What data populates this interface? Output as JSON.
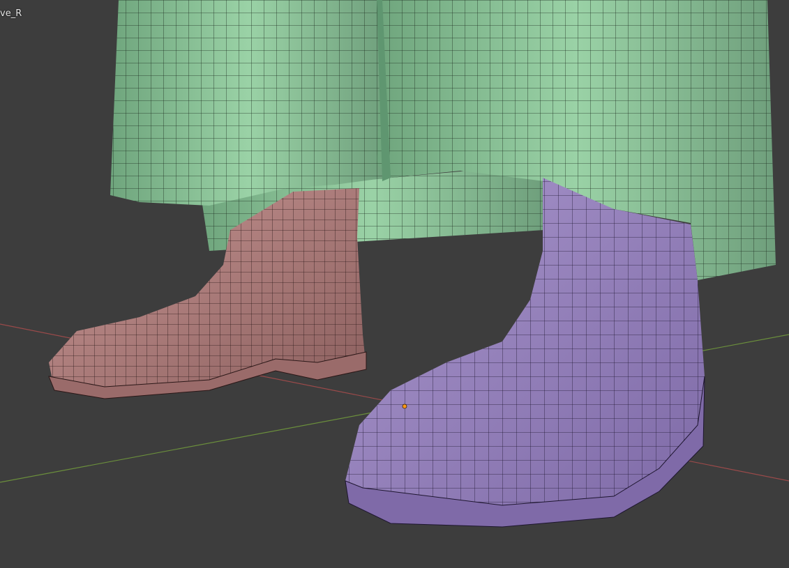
{
  "viewport": {
    "active_object_label": "ve_R",
    "background_color": "#3d3d3d"
  },
  "objects": {
    "trousers": {
      "color": "#8fc79c",
      "shade": "#5f9670"
    },
    "left_boot": {
      "color": "#b88584",
      "shade": "#7e5655"
    },
    "right_boot": {
      "color": "#9b86c2",
      "shade": "#6a5890"
    }
  },
  "axes": {
    "x_axis_color": "#9a4a4a",
    "y_axis_color": "#6b8f3c"
  },
  "origin_dot_color": "#ff9a1a"
}
